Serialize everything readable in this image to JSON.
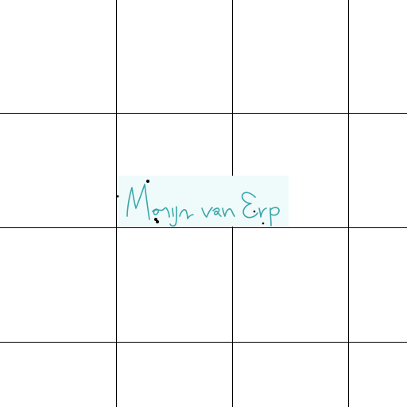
{
  "canvas": {
    "background_color": "#ffffff",
    "grid_line_color": "#000000"
  },
  "signature": {
    "text": "Merijn van Erp",
    "ink_color": "#3aa6a8",
    "panel_color": "#effafb",
    "marker_color": "#000000"
  }
}
